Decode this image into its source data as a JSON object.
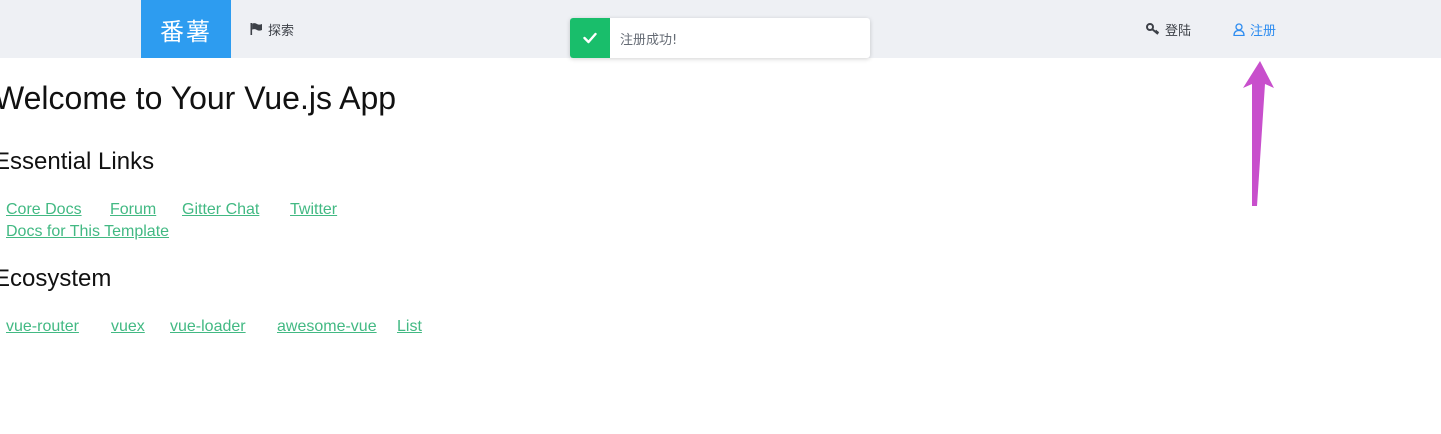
{
  "header": {
    "logo": "番薯",
    "explore_label": "探索",
    "login_label": "登陆",
    "register_label": "注册"
  },
  "toast": {
    "message": "注册成功!"
  },
  "main": {
    "title": "Welcome to Your Vue.js App",
    "essential_links_heading": "Essential Links",
    "essential_links": [
      "Core Docs",
      "Forum",
      "Gitter Chat",
      "Twitter",
      "Docs for This Template"
    ],
    "ecosystem_heading": "Ecosystem",
    "ecosystem_links": [
      "vue-router",
      "vuex",
      "vue-loader",
      "awesome-vue",
      "List"
    ]
  },
  "colors": {
    "brand": "#2d9cf0",
    "link": "#42b983",
    "success": "#19be6b",
    "annotation_arrow": "#c84fcc"
  },
  "icons": {
    "explore": "flag-icon",
    "login": "key-icon",
    "register": "user-icon",
    "toast": "check-icon"
  }
}
